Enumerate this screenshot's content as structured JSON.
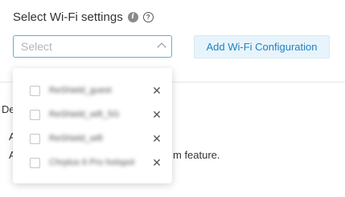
{
  "header": {
    "title": "Select Wi-Fi settings",
    "info_icon": "i",
    "help_icon": "?"
  },
  "select": {
    "placeholder": "Select"
  },
  "add_button": {
    "label": "Add Wi-Fi Configuration"
  },
  "background": {
    "line1": "De",
    "line2": "A",
    "line3": "A",
    "line3_tail": "m feature."
  },
  "dropdown": {
    "options": [
      {
        "label": "ReShield_guest",
        "checked": false
      },
      {
        "label": "ReShield_wifi_5G",
        "checked": false
      },
      {
        "label": "ReShield_wifi",
        "checked": false
      },
      {
        "label": "Chrplus 6 Pro hotspot",
        "checked": false
      }
    ],
    "remove_glyph": "✕"
  },
  "colors": {
    "accent": "#5ab4d6",
    "button_bg": "#e8f4fb",
    "button_text": "#1f82c0"
  }
}
